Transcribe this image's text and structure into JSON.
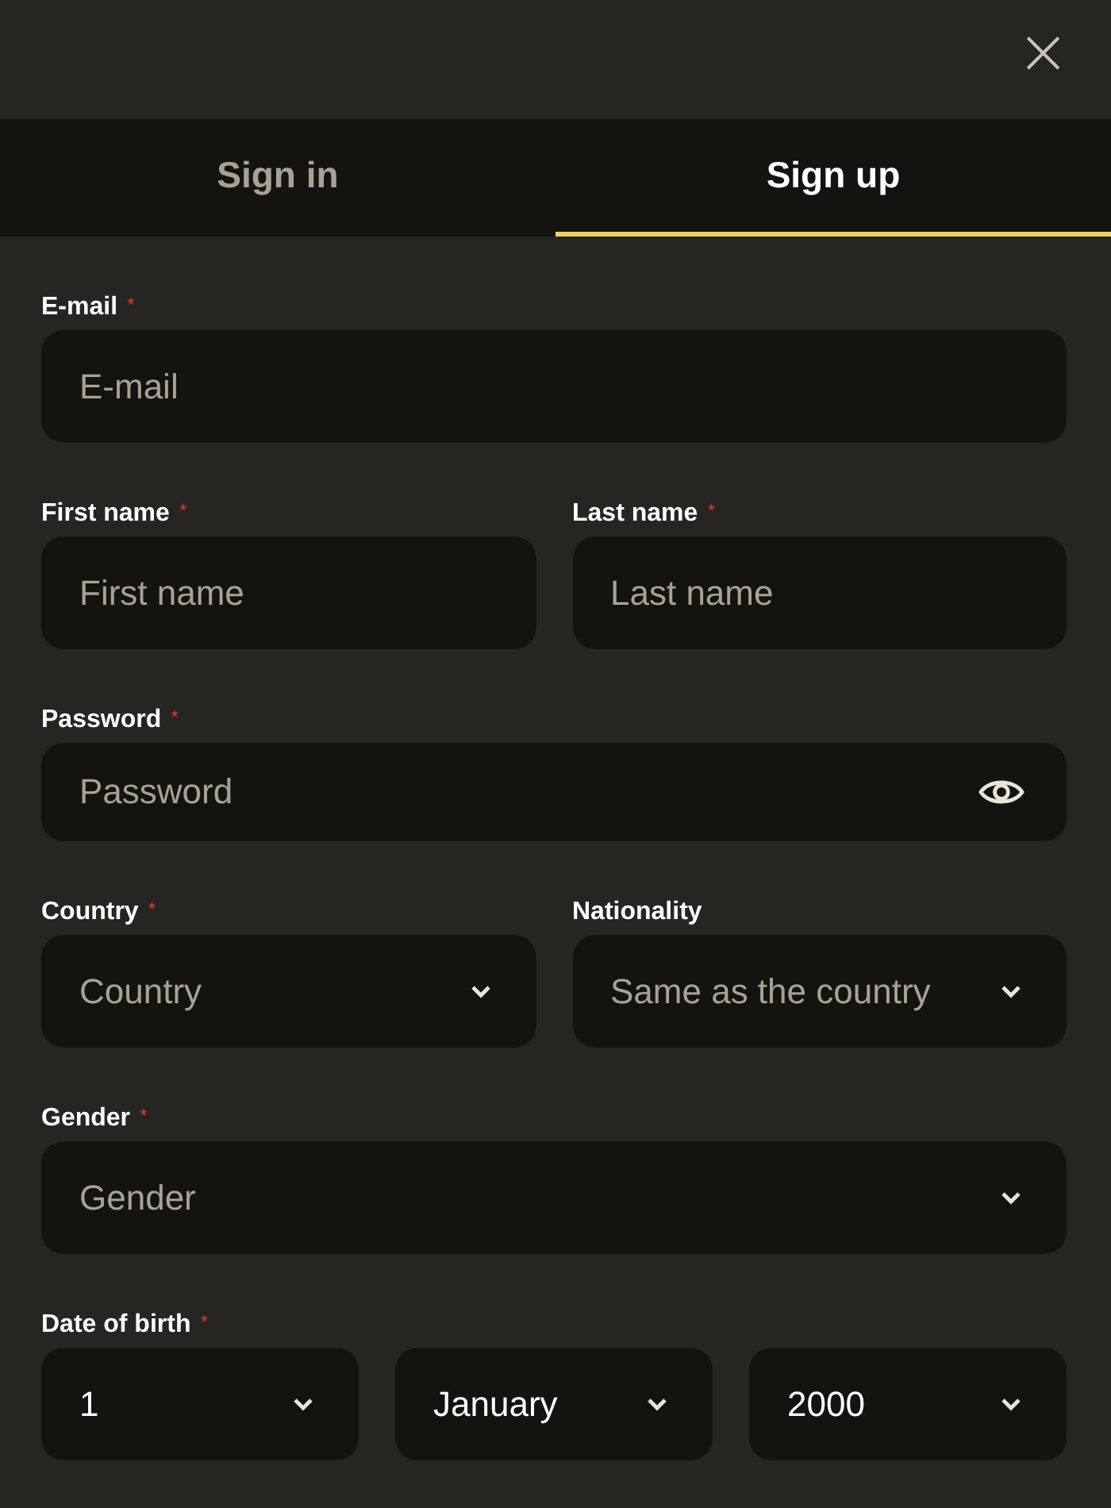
{
  "close_button": {
    "label": "×"
  },
  "tabs": [
    {
      "label": "Sign in",
      "selected": false
    },
    {
      "label": "Sign up",
      "selected": true
    }
  ],
  "rows": [
    {
      "fields": [
        {
          "label": "E-mail",
          "required": true,
          "kind": "text",
          "placeholder": "E-mail"
        }
      ]
    },
    {
      "fields": [
        {
          "label": "First name",
          "required": true,
          "kind": "text",
          "placeholder": "First name"
        },
        {
          "label": "Last name",
          "required": true,
          "kind": "text",
          "placeholder": "Last name"
        }
      ]
    },
    {
      "fields": [
        {
          "label": "Password",
          "required": true,
          "kind": "password",
          "placeholder": "Password"
        }
      ]
    },
    {
      "fields": [
        {
          "label": "Country",
          "required": true,
          "kind": "select",
          "placeholder": "Country"
        },
        {
          "label": "Nationality",
          "required": false,
          "kind": "select",
          "placeholder": "Same as the country"
        }
      ]
    },
    {
      "fields": [
        {
          "label": "Gender",
          "required": true,
          "kind": "select",
          "placeholder": "Gender"
        }
      ]
    },
    {
      "label": "Date of birth",
      "required": true,
      "fields": [
        {
          "kind": "select",
          "value": "1"
        },
        {
          "kind": "select",
          "value": "January"
        },
        {
          "kind": "select",
          "value": "2000"
        }
      ]
    }
  ]
}
